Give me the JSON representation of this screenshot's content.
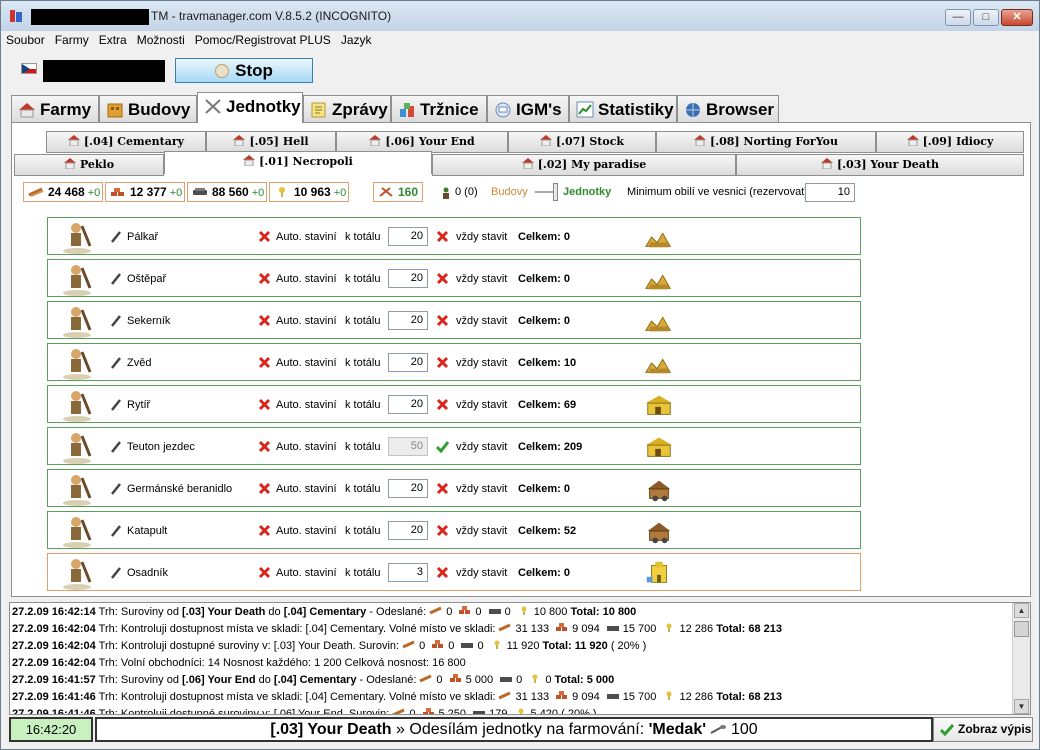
{
  "window": {
    "title": "TM - travmanager.com V.8.5.2 (INCOGNITO)",
    "controls": {
      "minimize": "—",
      "maximize": "□",
      "close": "✕"
    }
  },
  "menu": [
    "Soubor",
    "Farmy",
    "Extra",
    "Možnosti",
    "Pomoc/Registrovat PLUS",
    "Jazyk"
  ],
  "stop_label": "Stop",
  "main_tabs": [
    {
      "label": "Farmy",
      "icon": "farm-icon"
    },
    {
      "label": "Budovy",
      "icon": "building-icon"
    },
    {
      "label": "Jednotky",
      "icon": "swords-icon"
    },
    {
      "label": "Zprávy",
      "icon": "report-icon"
    },
    {
      "label": "Tržnice",
      "icon": "market-icon"
    },
    {
      "label": "IGM's",
      "icon": "message-icon"
    },
    {
      "label": "Statistiky",
      "icon": "chart-icon"
    },
    {
      "label": "Browser",
      "icon": "globe-icon"
    }
  ],
  "active_main_tab": "Jednotky",
  "village_tabs_row1": [
    "[.04] Cementary",
    "[.05] Hell",
    "[.06] Your End",
    "[.07] Stock",
    "[.08] Norting ForYou",
    "[.09] Idiocy"
  ],
  "village_tabs_row2": [
    "Peklo",
    "[.01] Necropoli",
    "[.02] My paradise",
    "[.03] Your Death"
  ],
  "active_village": "[.01] Necropoli",
  "resources": [
    {
      "value": "24 468",
      "delta": "+0",
      "icon": "wood-icon"
    },
    {
      "value": "12 377",
      "delta": "+0",
      "icon": "clay-icon"
    },
    {
      "value": "88 560",
      "delta": "+0",
      "icon": "iron-icon"
    },
    {
      "value": "10 963",
      "delta": "+0",
      "icon": "crop-icon"
    }
  ],
  "crop_consumption": "160",
  "troops_count": "0 (0)",
  "mode_left": "Budovy",
  "mode_right": "Jednotky",
  "reserve_label": "Minimum obilí ve vesnici (rezervovat)",
  "reserve_value": "10",
  "labels": {
    "auto_build": "Auto. staviní",
    "to_total": "k totálu",
    "always_build": "vždy stavit"
  },
  "units": [
    {
      "name": "Pálkař",
      "total": "20",
      "always": false,
      "celkem": "Celkem: 0",
      "building": "barracks"
    },
    {
      "name": "Oštěpař",
      "total": "20",
      "always": false,
      "celkem": "Celkem: 0",
      "building": "barracks"
    },
    {
      "name": "Sekerník",
      "total": "20",
      "always": false,
      "celkem": "Celkem: 0",
      "building": "barracks"
    },
    {
      "name": "Zvěd",
      "total": "20",
      "always": false,
      "celkem": "Celkem: 10",
      "building": "barracks"
    },
    {
      "name": "Rytíř",
      "total": "20",
      "always": false,
      "celkem": "Celkem: 69",
      "building": "stable"
    },
    {
      "name": "Teuton jezdec",
      "total": "50",
      "always": true,
      "disabled": true,
      "celkem": "Celkem: 209",
      "building": "stable"
    },
    {
      "name": "Germánské beranidlo",
      "total": "20",
      "always": false,
      "celkem": "Celkem: 0",
      "building": "workshop"
    },
    {
      "name": "Katapult",
      "total": "20",
      "always": false,
      "celkem": "Celkem: 52",
      "building": "workshop"
    },
    {
      "name": "Osadník",
      "total": "3",
      "always": false,
      "celkem": "Celkem: 0",
      "building": "palace"
    }
  ],
  "log": [
    {
      "ts": "27.2.09 16:42:14",
      "a": "Trh: Suroviny od ",
      "b1": "[.03] Your Death",
      "c": " do ",
      "b2": "[.04] Cementary",
      "d": " - Odeslané:",
      "r": [
        "0",
        "0",
        "0",
        "10 800"
      ],
      "e": "Total: 10 800",
      "f": ""
    },
    {
      "ts": "27.2.09 16:42:04",
      "a": "Trh: Kontroluji dostupnost místa ve skladi: [.04] Cementary. Volné místo ve skladi:",
      "b1": "",
      "c": "",
      "b2": "",
      "d": "",
      "r": [
        "31 133",
        "9 094",
        "15 700",
        "12 286"
      ],
      "e": "Total: 68 213",
      "f": ""
    },
    {
      "ts": "27.2.09 16:42:04",
      "a": "Trh: Kontroluji dostupné suroviny v: [.03] Your Death. Surovin:",
      "b1": "",
      "c": "",
      "b2": "",
      "d": "",
      "r": [
        "0",
        "0",
        "0",
        "11 920"
      ],
      "e": "Total: 11 920",
      "f": " ( 20% )"
    },
    {
      "ts": "27.2.09 16:42:04",
      "a": "Trh: Volní obchodníci: 14 Nosnost každého: 1 200 Celková nosnost: 16 800",
      "b1": "",
      "c": "",
      "b2": "",
      "d": "",
      "r": [],
      "e": "",
      "f": ""
    },
    {
      "ts": "27.2.09 16:41:57",
      "a": "Trh: Suroviny od ",
      "b1": "[.06] Your End",
      "c": " do ",
      "b2": "[.04] Cementary",
      "d": " - Odeslané:",
      "r": [
        "0",
        "5 000",
        "0",
        "0"
      ],
      "e": "Total: 5 000",
      "f": ""
    },
    {
      "ts": "27.2.09 16:41:46",
      "a": "Trh: Kontroluji dostupnost místa ve skladi: [.04] Cementary. Volné místo ve skladi:",
      "b1": "",
      "c": "",
      "b2": "",
      "d": "",
      "r": [
        "31 133",
        "9 094",
        "15 700",
        "12 286"
      ],
      "e": "Total: 68 213",
      "f": ""
    },
    {
      "ts": "27.2.09 16:41:46",
      "a": "Trh: Kontroluji dostupné suroviny v: [.06] Your End. Surovin:",
      "b1": "",
      "c": "",
      "b2": "",
      "d": "",
      "r": [
        "0",
        "5 250",
        "179",
        "5 420"
      ],
      "e": "",
      "f": " ( 20% )"
    }
  ],
  "status": {
    "clock": "16:42:20",
    "village": "[.03] Your Death",
    "arrow": "»",
    "message": "Odesílám jednotky na farmování:",
    "farm": "'Medak'",
    "count": "100",
    "button": "Zobraz výpis"
  },
  "colors": {
    "wood": "#b86a2b",
    "clay": "#c0522a",
    "iron": "#4d4d4d",
    "crop": "#e6c23a",
    "ok": "#2e9e2e",
    "x": "#d9261c",
    "mode_right": "#2e8b2e",
    "mode_left": "#d08a3c"
  }
}
